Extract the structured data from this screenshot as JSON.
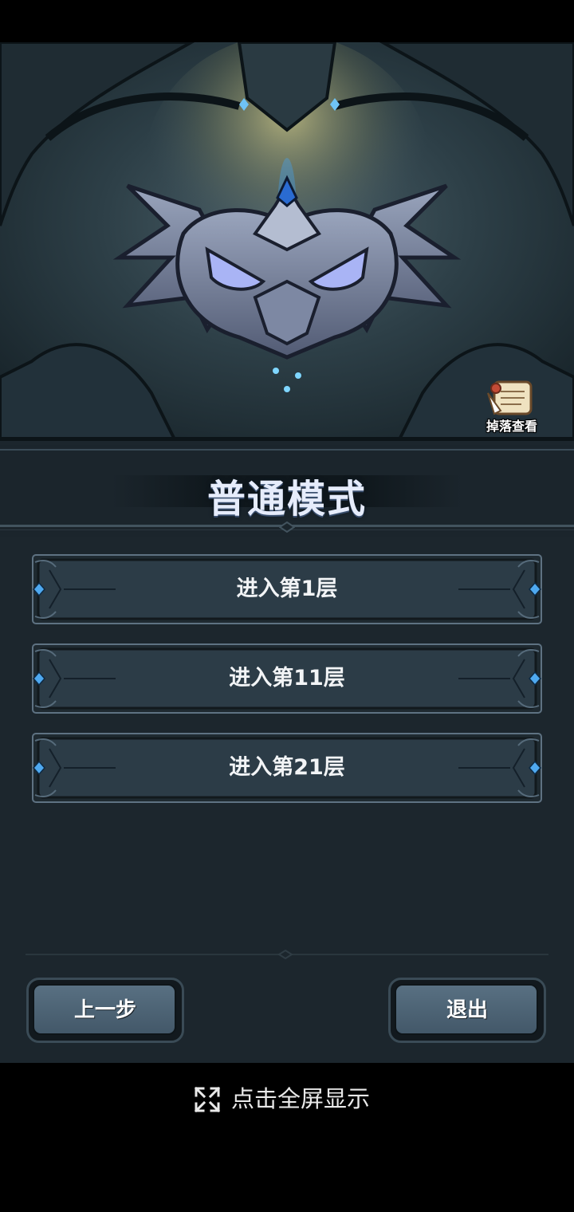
{
  "header": {
    "drop_view_label": "掉落查看"
  },
  "mode": {
    "title": "普通模式"
  },
  "floors": [
    {
      "label": "进入第1层"
    },
    {
      "label": "进入第11层"
    },
    {
      "label": "进入第21层"
    }
  ],
  "footer": {
    "back_label": "上一步",
    "exit_label": "退出"
  },
  "fullscreen": {
    "label": "点击全屏显示",
    "icon": "expand-icon"
  },
  "colors": {
    "background": "#1c262d",
    "title_text": "#e6ecfb",
    "button_fill": "#2f3f4a",
    "gem_accent": "#4fa9f0"
  }
}
